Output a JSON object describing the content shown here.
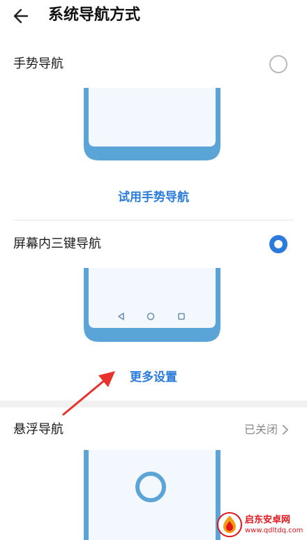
{
  "header": {
    "title": "系统导航方式"
  },
  "options": [
    {
      "label": "手势导航",
      "selected": false,
      "action": "试用手势导航"
    },
    {
      "label": "屏幕内三键导航",
      "selected": true,
      "action": "更多设置"
    },
    {
      "label": "悬浮导航",
      "status": "已关闭"
    }
  ],
  "watermark": {
    "name": "启东安卓网",
    "url": "www.qdltdq.com"
  },
  "icons": {
    "back": "arrow-left-icon",
    "radio_off": "radio-unchecked-icon",
    "radio_on": "radio-checked-icon",
    "nav_back": "triangle-back-icon",
    "nav_home": "circle-home-icon",
    "nav_recent": "square-recent-icon",
    "float_ball": "floating-ball-icon",
    "chevron": "chevron-right-icon"
  },
  "colors": {
    "accent": "#2a7bdc",
    "phone_frame": "#5ba4d8",
    "phone_screen": "#f2f8fd",
    "annotation_arrow": "#e8312c",
    "watermark_red": "#e0161b"
  }
}
